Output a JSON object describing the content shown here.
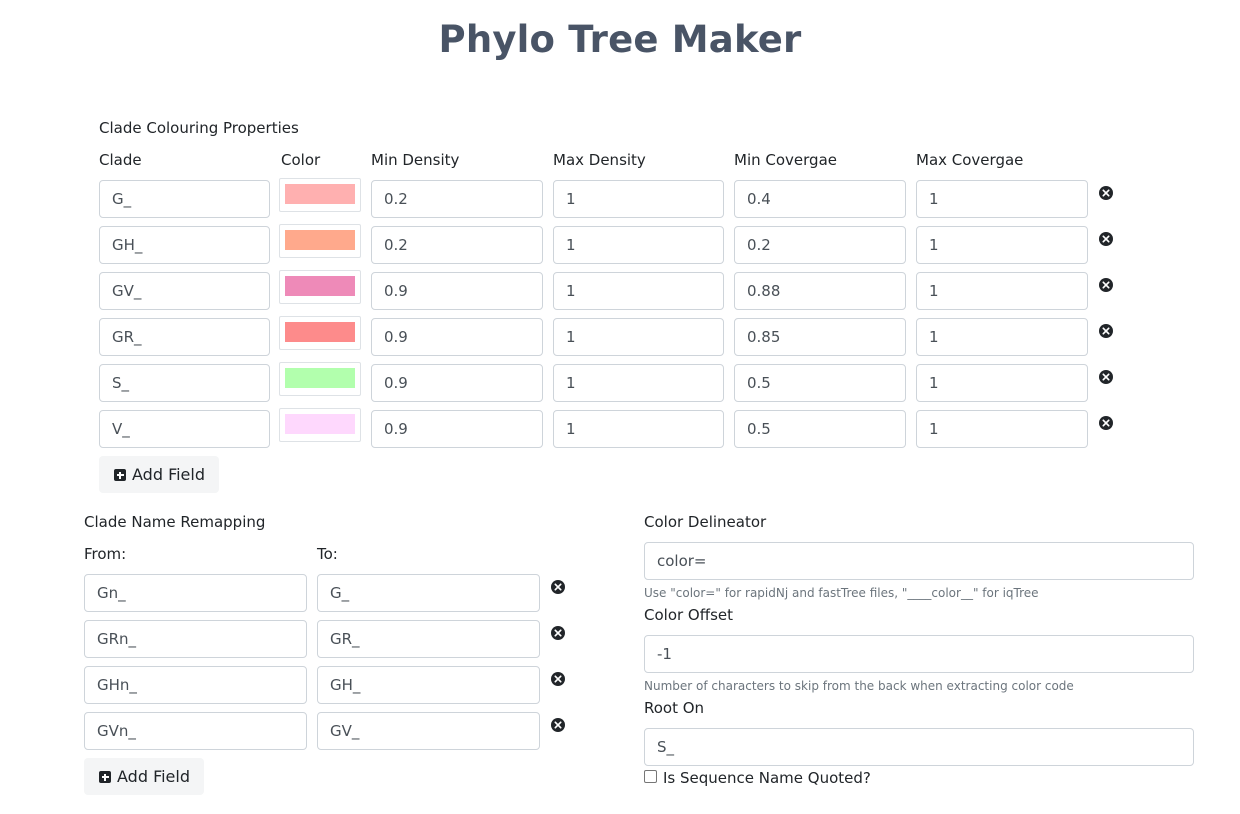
{
  "page": {
    "title": "Phylo Tree Maker"
  },
  "clade_colouring": {
    "heading": "Clade Colouring Properties",
    "headers": {
      "clade": "Clade",
      "color": "Color",
      "min_density": "Min Density",
      "max_density": "Max Density",
      "min_coverage": "Min Covergae",
      "max_coverage": "Max Covergae"
    },
    "rows": [
      {
        "clade": "G_",
        "color": "#ffb0b0",
        "min_density": "0.2",
        "max_density": "1",
        "min_coverage": "0.4",
        "max_coverage": "1"
      },
      {
        "clade": "GH_",
        "color": "#ffa98c",
        "min_density": "0.2",
        "max_density": "1",
        "min_coverage": "0.2",
        "max_coverage": "1"
      },
      {
        "clade": "GV_",
        "color": "#ee8ab8",
        "min_density": "0.9",
        "max_density": "1",
        "min_coverage": "0.88",
        "max_coverage": "1"
      },
      {
        "clade": "GR_",
        "color": "#fd8b8b",
        "min_density": "0.9",
        "max_density": "1",
        "min_coverage": "0.85",
        "max_coverage": "1"
      },
      {
        "clade": "S_",
        "color": "#b2ffad",
        "min_density": "0.9",
        "max_density": "1",
        "min_coverage": "0.5",
        "max_coverage": "1"
      },
      {
        "clade": "V_",
        "color": "#fed8fd",
        "min_density": "0.9",
        "max_density": "1",
        "min_coverage": "0.5",
        "max_coverage": "1"
      }
    ],
    "add_label": "Add Field"
  },
  "remapping": {
    "heading": "Clade Name Remapping",
    "from_label": "From:",
    "to_label": "To:",
    "rows": [
      {
        "from": "Gn_",
        "to": "G_"
      },
      {
        "from": "GRn_",
        "to": "GR_"
      },
      {
        "from": "GHn_",
        "to": "GH_"
      },
      {
        "from": "GVn_",
        "to": "GV_"
      }
    ],
    "add_label": "Add Field"
  },
  "settings": {
    "delineator_label": "Color Delineator",
    "delineator_value": "color=",
    "delineator_help": "Use \"color=\" for rapidNj and fastTree files, \"____color__\" for iqTree",
    "offset_label": "Color Offset",
    "offset_value": "-1",
    "offset_help": "Number of characters to skip from the back when extracting color code",
    "root_label": "Root On",
    "root_value": "S_",
    "quoted_label": "Is Sequence Name Quoted?",
    "quoted_checked": false
  }
}
